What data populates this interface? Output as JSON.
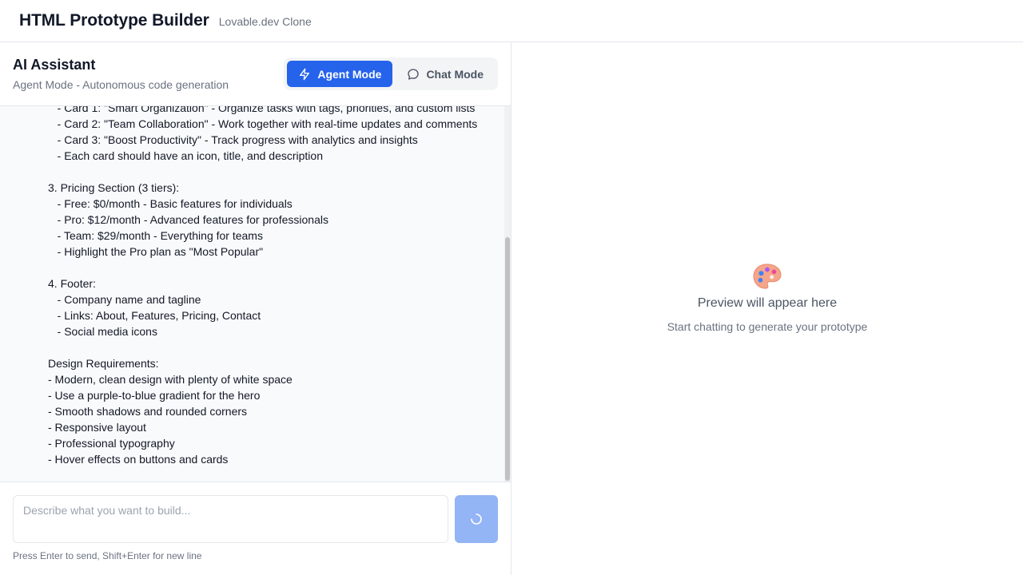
{
  "header": {
    "title": "HTML Prototype Builder",
    "subtitle": "Lovable.dev Clone"
  },
  "assistant": {
    "title": "AI Assistant",
    "subtitle": "Agent Mode - Autonomous code generation",
    "modes": [
      {
        "label": "Agent Mode",
        "icon": "lightning-icon",
        "active": true
      },
      {
        "label": "Chat Mode",
        "icon": "chat-bubble-icon",
        "active": false
      }
    ]
  },
  "conversation": {
    "message_text": "   - Card 1: \"Smart Organization\" - Organize tasks with tags, priorities, and custom lists\n   - Card 2: \"Team Collaboration\" - Work together with real-time updates and comments\n   - Card 3: \"Boost Productivity\" - Track progress with analytics and insights\n   - Each card should have an icon, title, and description\n\n3. Pricing Section (3 tiers):\n   - Free: $0/month - Basic features for individuals\n   - Pro: $12/month - Advanced features for professionals\n   - Team: $29/month - Everything for teams\n   - Highlight the Pro plan as \"Most Popular\"\n\n4. Footer:\n   - Company name and tagline\n   - Links: About, Features, Pricing, Contact\n   - Social media icons\n\nDesign Requirements:\n- Modern, clean design with plenty of white space\n- Use a purple-to-blue gradient for the hero\n- Smooth shadows and rounded corners\n- Responsive layout\n- Professional typography\n- Hover effects on buttons and cards"
  },
  "composer": {
    "placeholder": "Describe what you want to build...",
    "value": "",
    "send_state": "loading",
    "hint": "Press Enter to send, Shift+Enter for new line"
  },
  "preview": {
    "icon": "palette-icon",
    "title": "Preview will appear here",
    "subtitle": "Start chatting to generate your prototype"
  },
  "colors": {
    "accent": "#2563eb",
    "send_disabled": "#93b4f5",
    "border": "#e5e7eb",
    "chat_bg": "#f9fafb"
  }
}
